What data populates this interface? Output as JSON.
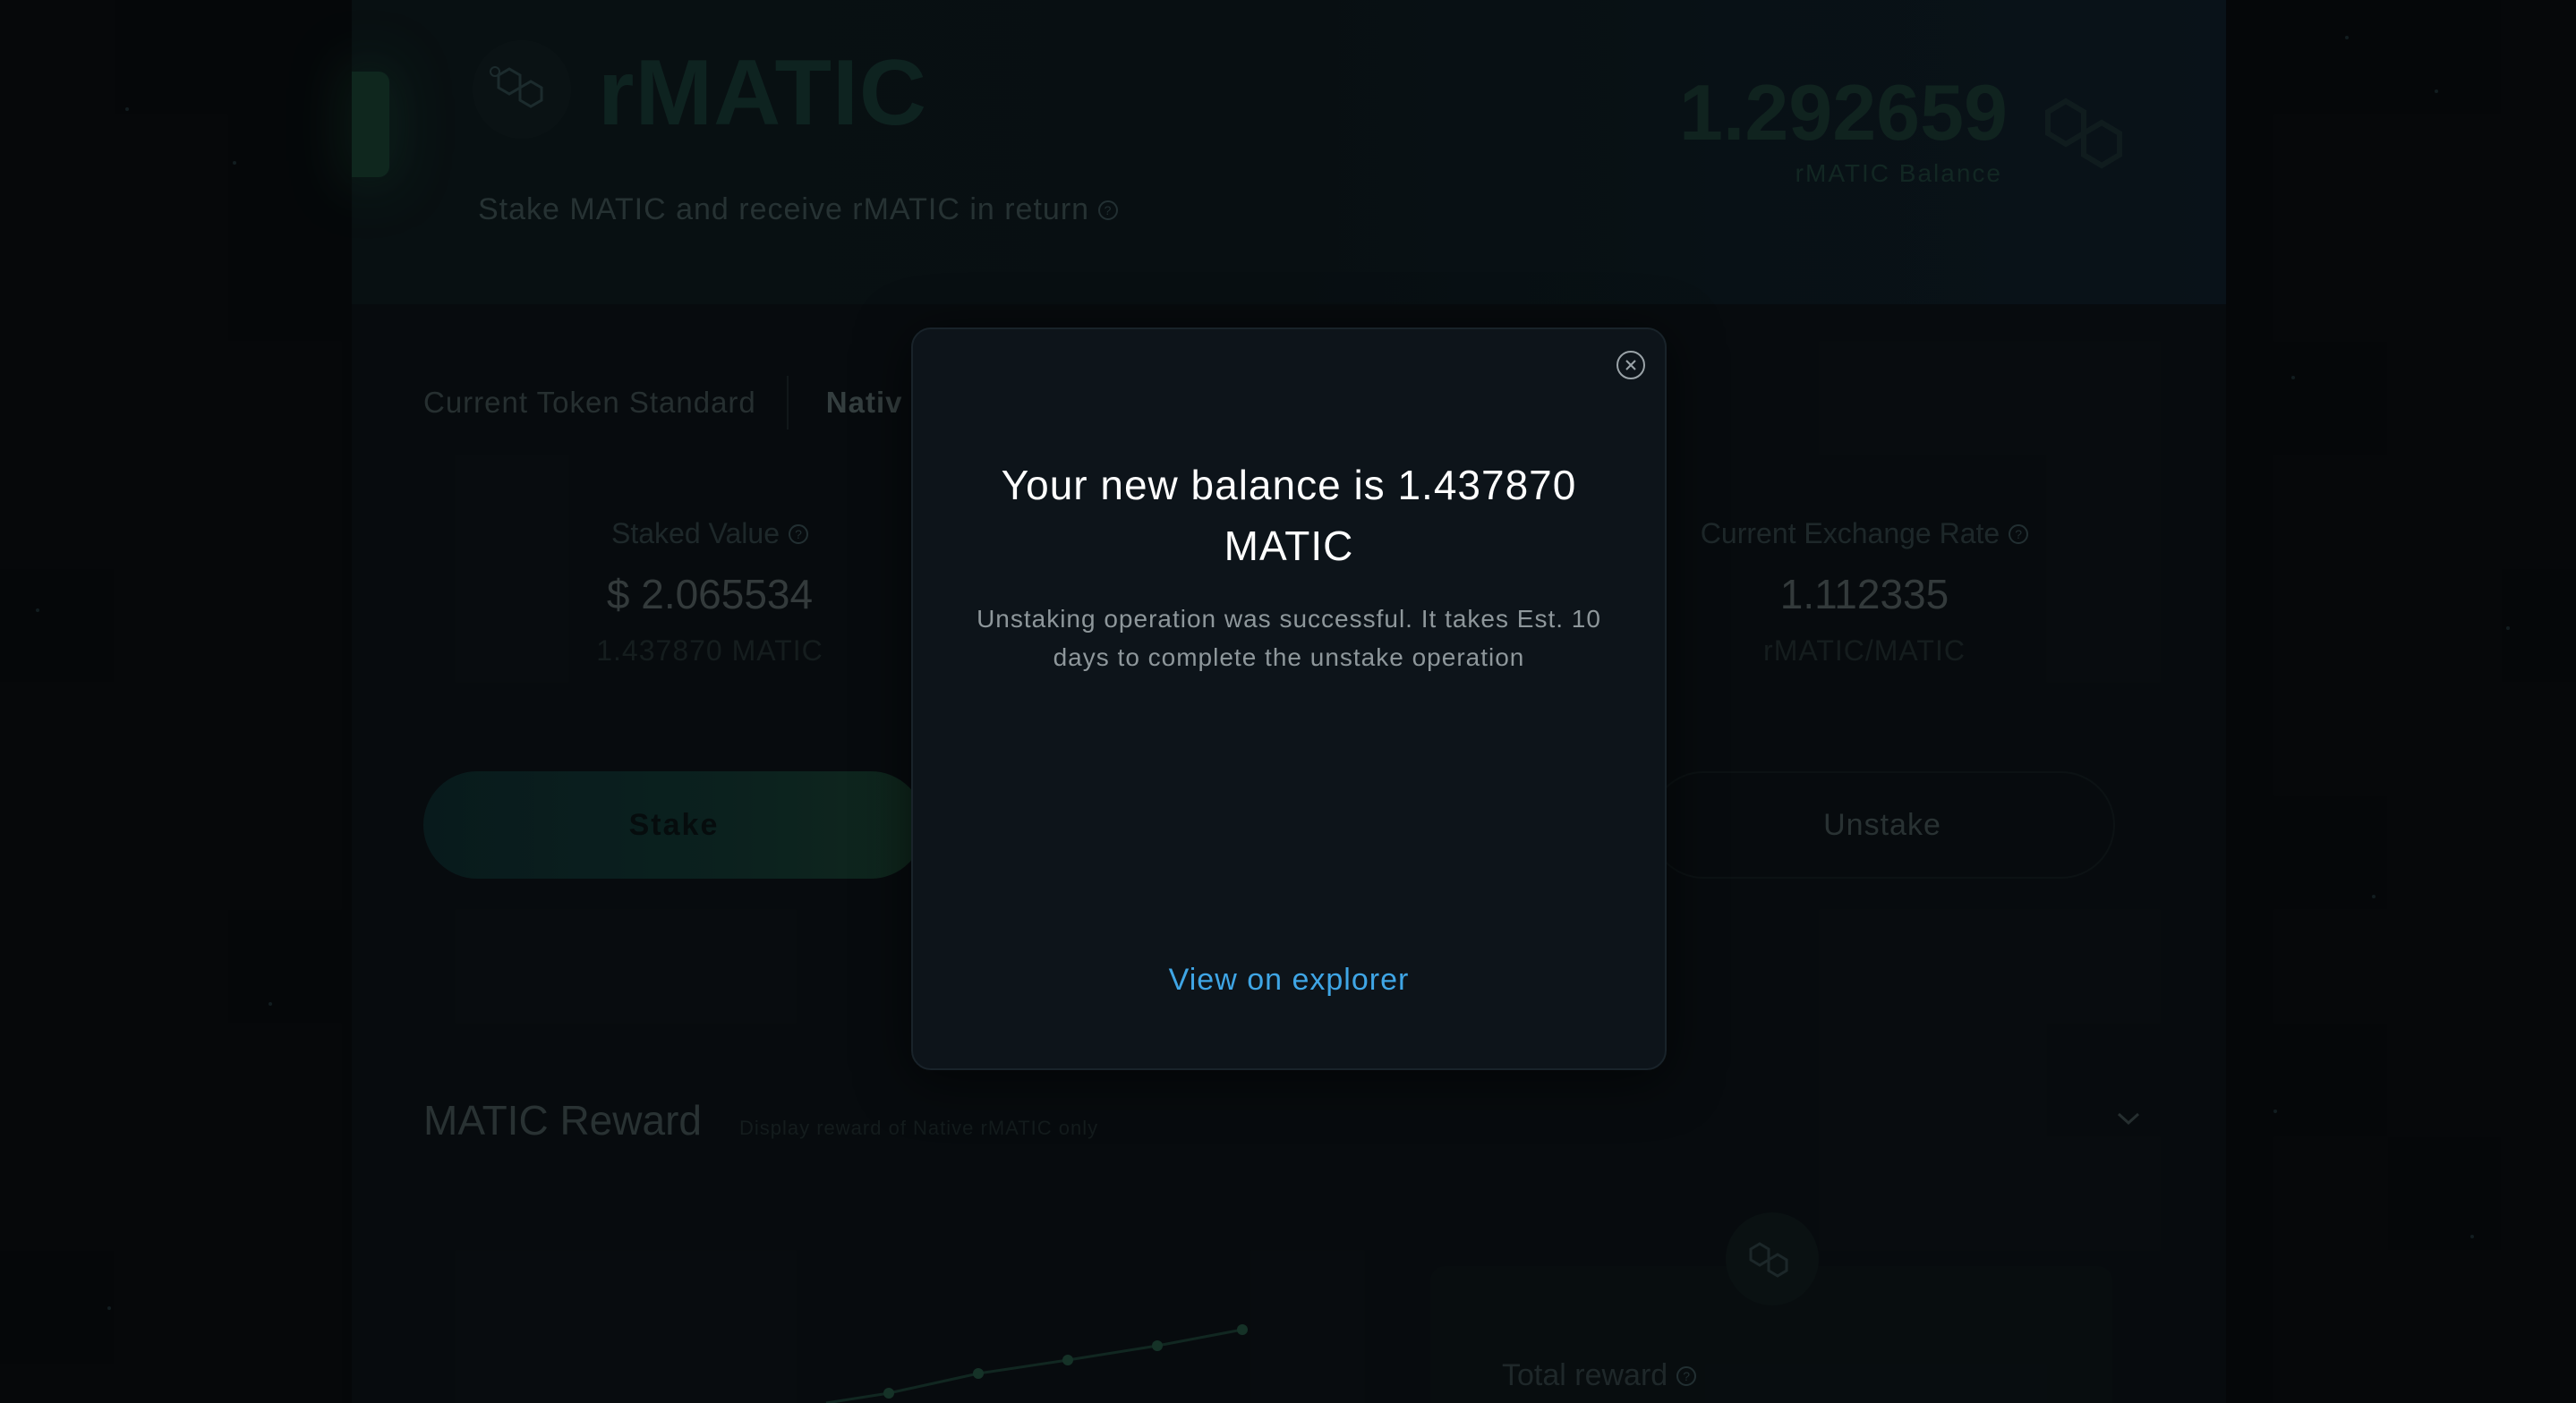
{
  "header": {
    "token_title": "rMATIC",
    "subtitle": "Stake MATIC and receive rMATIC in return",
    "balance_value": "1.292659",
    "balance_label": "rMATIC Balance"
  },
  "tabs": {
    "current_label": "Current Token Standard",
    "active_label": "Nativ"
  },
  "stats": {
    "staked": {
      "label": "Staked Value",
      "value": "$ 2.065534",
      "sub": "1.437870 MATIC"
    },
    "rate": {
      "label": "Current Exchange Rate",
      "value": "1.112335",
      "sub": "rMATIC/MATIC"
    }
  },
  "actions": {
    "stake_label": "Stake",
    "unstake_label": "Unstake"
  },
  "reward": {
    "title": "MATIC Reward",
    "subtitle": "Display reward of Native rMATIC only",
    "total_label": "Total reward"
  },
  "modal": {
    "title": "Your new balance is 1.437870 MATIC",
    "message": "Unstaking operation was successful. It takes Est. 10 days to complete the unstake operation",
    "link_label": "View on explorer"
  },
  "icons": {
    "token": "matic-icon",
    "info": "question-icon",
    "close": "close-circle-icon",
    "expand": "chevron-down-icon"
  },
  "colors": {
    "accent_green": "#17332d",
    "link_blue": "#3fa6e6",
    "modal_bg": "#0d141a"
  }
}
